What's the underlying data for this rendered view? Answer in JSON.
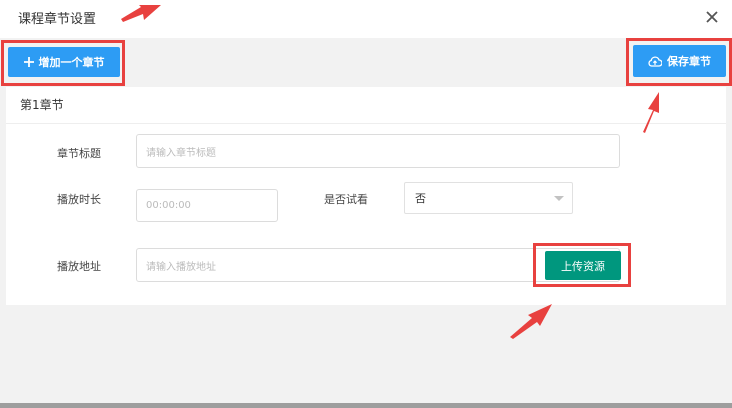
{
  "dialog": {
    "title": "课程章节设置",
    "close_icon": "close-icon"
  },
  "toolbar": {
    "add_chapter_label": "增加一个章节",
    "save_chapter_label": "保存章节"
  },
  "chapter": {
    "heading": "第1章节",
    "title_label": "章节标题",
    "title_placeholder": "请输入章节标题",
    "duration_label": "播放时长",
    "duration_placeholder": "00:00:00",
    "trial_label": "是否试看",
    "trial_value": "否",
    "url_label": "播放地址",
    "url_placeholder": "请输入播放地址",
    "upload_label": "上传资源"
  },
  "colors": {
    "primary": "#2d9cf4",
    "upload": "#00977e",
    "annotation": "#e8413f"
  }
}
